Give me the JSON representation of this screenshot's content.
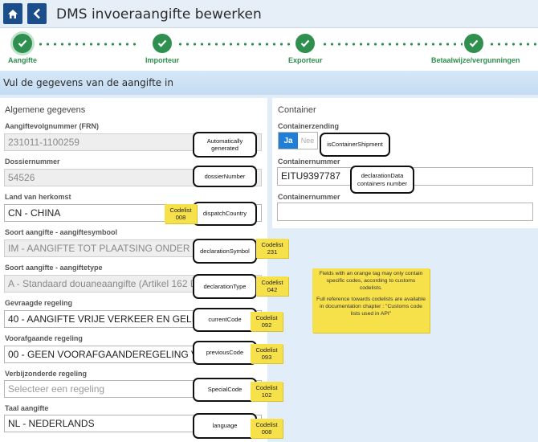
{
  "header": {
    "title": "DMS invoeraangifte bewerken"
  },
  "stepper": {
    "steps": [
      {
        "label": "Aangifte",
        "active": true
      },
      {
        "label": "Importeur"
      },
      {
        "label": "Exporteur"
      },
      {
        "label": "Betaalwijze/vergunningen"
      }
    ]
  },
  "section": {
    "title": "Vul de gegevens van de aangifte in"
  },
  "left_panel": {
    "title": "Algemene gegevens",
    "fields": [
      {
        "label": "Aangiftevolgnummer (FRN)",
        "value": "231011-1100259",
        "state": "disabled"
      },
      {
        "label": "Dossiernummer",
        "value": "54526",
        "state": "disabled"
      },
      {
        "label": "Land van herkomst",
        "value": "CN - CHINA",
        "state": "enabled"
      },
      {
        "label": "Soort aangifte - aangiftesymbool",
        "value": "IM - AANGIFTE TOT PLAATSING ONDER DOUANEREGELING",
        "state": "disabled"
      },
      {
        "label": "Soort aangifte - aangiftetype",
        "value": "A - Standaard douaneaangifte (Artikel 162 DWU)",
        "state": "disabled"
      },
      {
        "label": "Gevraagde regeling",
        "value": "40 - AANGIFTE VRIJE VERKEER EN GELIJKTIJDIG",
        "state": "enabled"
      },
      {
        "label": "Voorafgaande regeling",
        "value": "00 - GEEN VOORAFGAANDEREGELING VAN TOEPASSING",
        "state": "enabled"
      },
      {
        "label": "Verbijzonderde regeling",
        "placeholder": "Selecteer een regeling",
        "state": "enabled"
      },
      {
        "label": "Taal aangifte",
        "value": "NL - NEDERLANDS",
        "state": "enabled"
      }
    ]
  },
  "right_panel": {
    "title": "Container",
    "containerzending": {
      "label": "Containerzending",
      "yes": "Ja",
      "no": "Nee"
    },
    "containernummer_1": {
      "label": "Containernummer",
      "value": "EITU9397787"
    },
    "containernummer_2": {
      "label": "Containernummer",
      "value": ""
    }
  },
  "tags": {
    "frn": "Automatically generated",
    "dossier": "dossierNumber",
    "dispatch": "dispatchCountry",
    "symbol": "declarationSymbol",
    "type": "declarationType",
    "current": "currentCode",
    "previous": "previousCode",
    "special": "SpecialCode",
    "language": "language",
    "container_shipment": "isContainerShipment",
    "containers": "declarationData containers number"
  },
  "codelists": {
    "dispatch": "Codelist 008",
    "symbol": "Codelist 231",
    "type": "Codelist 042",
    "current": "Codelist 092",
    "previous": "Codelist 093",
    "special": "Codelist 102",
    "language": "Codelist 008"
  },
  "note": {
    "line1": "Fields with an orange tag may only contain specific codes, according to customs codelists.",
    "line2": "Full reference towards codelists are available in documentation chapter : \"Customs code lists used in API\""
  },
  "colors": {
    "accent_green": "#2f8f4e",
    "primary_blue": "#1d4e8c",
    "toggle_blue": "#1f7fd6",
    "sticky_yellow": "#f7e14b"
  }
}
